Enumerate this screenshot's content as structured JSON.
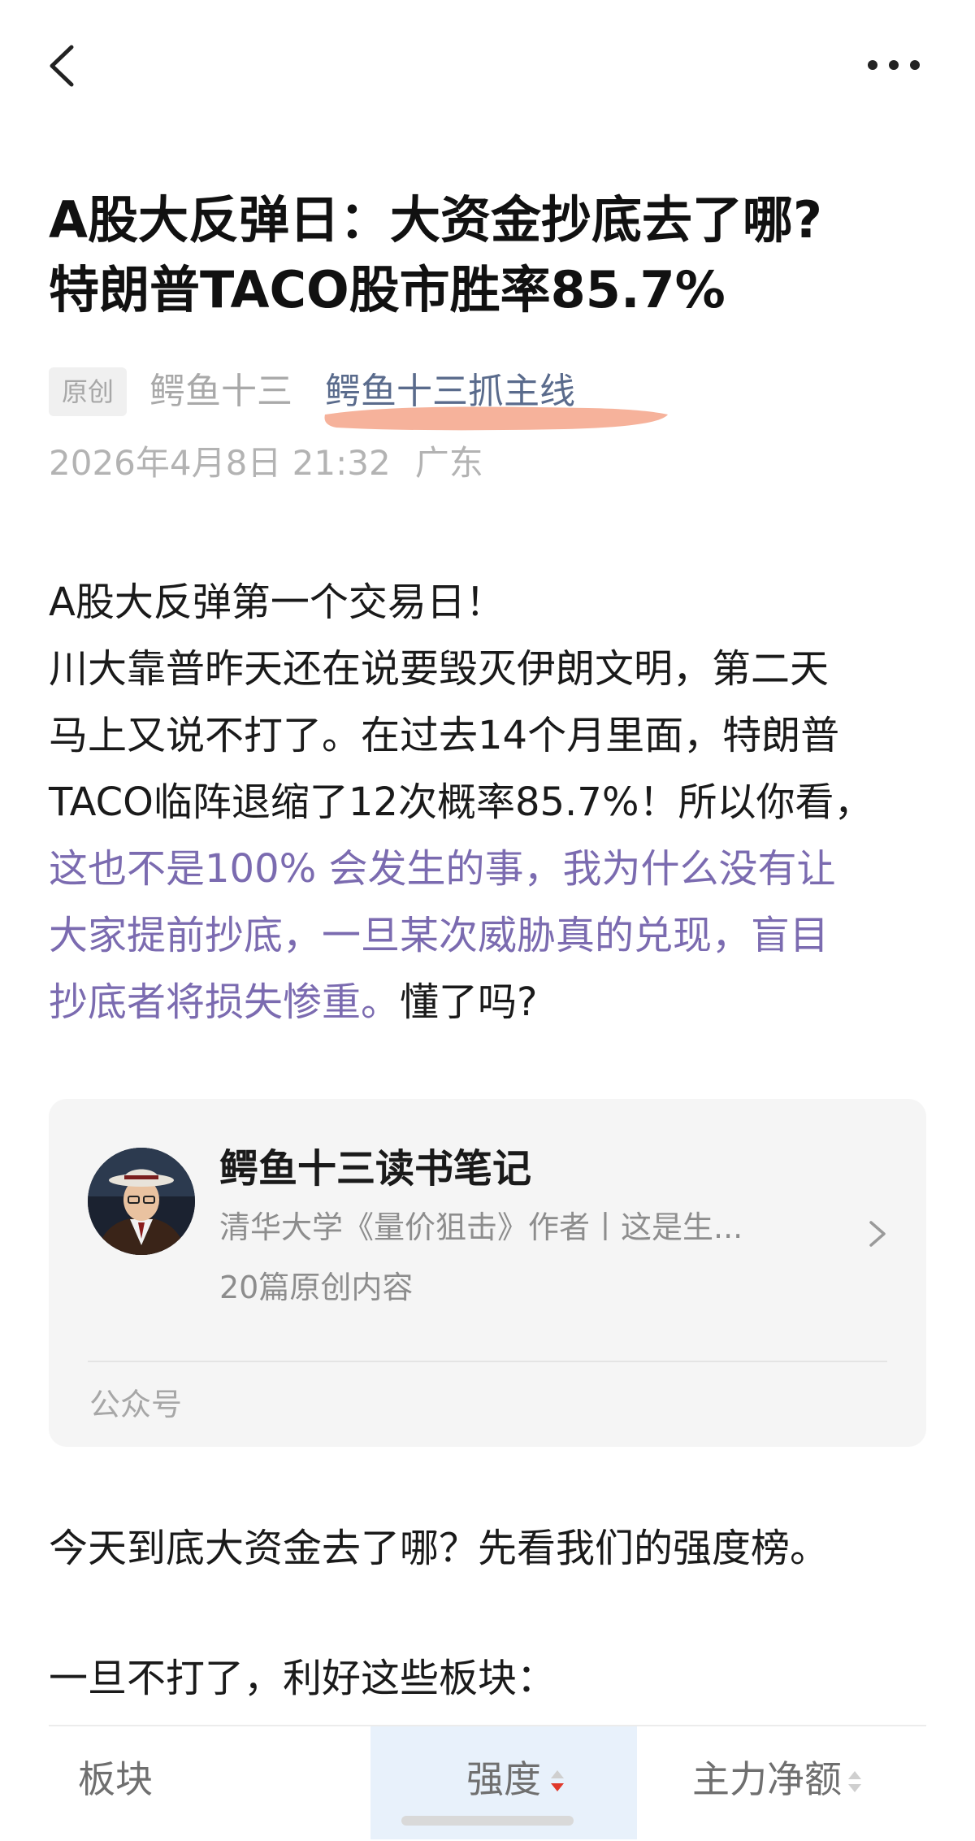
{
  "article": {
    "title_line1": "A股大反弹日：大资金抄底去了哪?",
    "title_line2": "特朗普TACO股市胜率85.7%",
    "badge": "原创",
    "author": "鳄鱼十三",
    "account_link": "鳄鱼十三抓主线",
    "date": "2026年4月8日 21:32",
    "location": "广东"
  },
  "body": {
    "line1": "A股大反弹第一个交易日！",
    "line2": "川大靠普昨天还在说要毁灭伊朗文明，第二天",
    "line3": "马上又说不打了。在过去14个月里面，特朗普",
    "line4": "TACO临阵退缩了12次概率85.7%！所以你看，",
    "line5_highlight": "这也不是100% 会发生的事，我为什么没有让",
    "line6_highlight": "大家提前抄底，一旦某次威胁真的兑现，盲目",
    "line7_highlight": "抄底者将损失惨重。",
    "line7_rest": "懂了吗?",
    "para2": "今天到底大资金去了哪？先看我们的强度榜。",
    "para3": "一旦不打了，利好这些板块："
  },
  "account_card": {
    "name": "鳄鱼十三读书笔记",
    "description": "清华大学《量价狙击》作者丨这是生...",
    "count": "20篇原创内容",
    "footer": "公众号"
  },
  "table": {
    "headers": [
      "板块",
      "强度",
      "主力净额"
    ]
  },
  "icons": {
    "back": "back-arrow-icon",
    "more": "more-dots-icon",
    "chevron": "chevron-right-icon",
    "sort": "sort-icon"
  },
  "colors": {
    "highlight_text": "#7b6bb0",
    "link": "#5a6b8c",
    "underline_marker": "#f4a48a",
    "sort_active": "#e0392b"
  }
}
